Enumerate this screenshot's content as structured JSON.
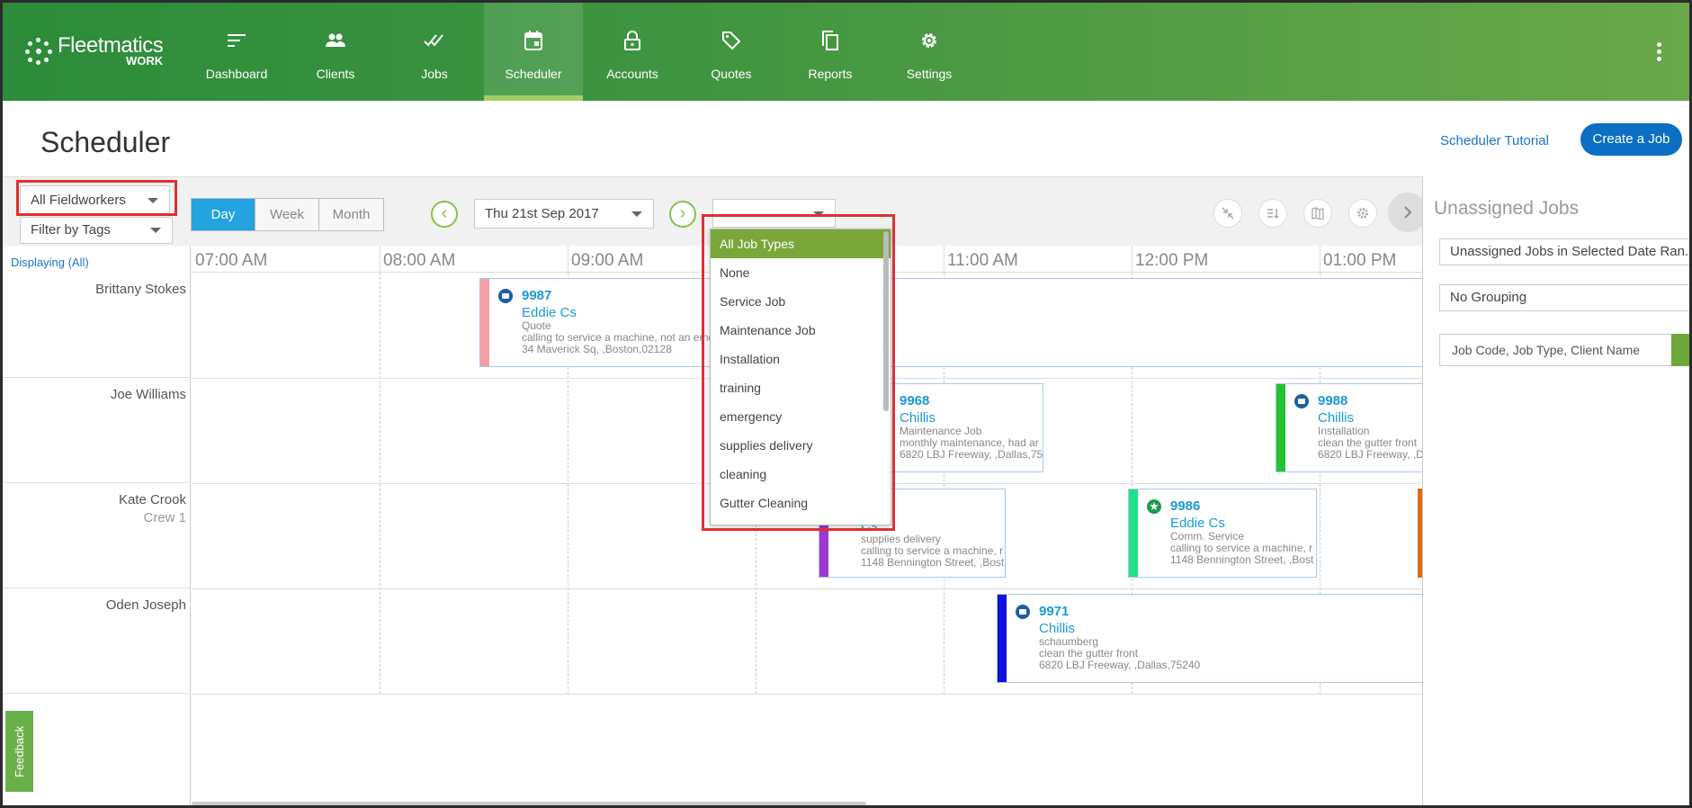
{
  "app": {
    "logo_name": "Fleetmatics",
    "logo_sub": "WORK"
  },
  "nav": [
    {
      "label": "Dashboard",
      "icon": "dashboard-icon"
    },
    {
      "label": "Clients",
      "icon": "clients-icon"
    },
    {
      "label": "Jobs",
      "icon": "jobs-icon"
    },
    {
      "label": "Scheduler",
      "icon": "calendar-icon",
      "active": true
    },
    {
      "label": "Accounts",
      "icon": "lock-icon"
    },
    {
      "label": "Quotes",
      "icon": "tag-icon"
    },
    {
      "label": "Reports",
      "icon": "copy-icon"
    },
    {
      "label": "Settings",
      "icon": "gear-icon"
    }
  ],
  "header": {
    "title": "Scheduler",
    "tutorial_link": "Scheduler Tutorial",
    "create_button": "Create a Job"
  },
  "filters": {
    "fieldworkers": "All Fieldworkers",
    "tags_placeholder": "Filter by Tags",
    "view_modes": [
      "Day",
      "Week",
      "Month"
    ],
    "active_view": "Day",
    "date": "Thu 21st Sep 2017",
    "job_type_value": ""
  },
  "job_types": [
    "All Job Types",
    "None",
    "Service Job",
    "Maintenance Job",
    "Installation",
    "training",
    "emergency",
    "supplies delivery",
    "cleaning",
    "Gutter Cleaning"
  ],
  "grid": {
    "displaying": "Displaying (All)",
    "hours": [
      "07:00 AM",
      "08:00 AM",
      "09:00 AM",
      "11:00 AM",
      "12:00 PM",
      "01:00 PM"
    ],
    "workers": [
      {
        "name": "Brittany Stokes",
        "crew": ""
      },
      {
        "name": "Joe Williams",
        "crew": ""
      },
      {
        "name": "Kate Crook",
        "crew": "Crew 1"
      },
      {
        "name": "Oden Joseph",
        "crew": ""
      }
    ]
  },
  "jobs": {
    "j9987": {
      "code": "9987",
      "client": "Eddie Cs",
      "type": "Quote",
      "desc": "calling to service a machine, not an eme",
      "addr": "34 Maverick Sq, ,Boston,02128",
      "color": "#f4a0a8"
    },
    "j9968": {
      "code": "9968",
      "client": "Chillis",
      "type": "Maintenance Job",
      "desc": "monthly maintenance, had ar",
      "addr": "6820 LBJ Freeway, ,Dallas,752",
      "color": "#9a7fd0"
    },
    "j9988": {
      "code": "9988",
      "client": "Chillis",
      "type": "Installation",
      "desc": "clean the gutter front",
      "addr": "6820 LBJ Freeway, ,Da",
      "color": "#22c230"
    },
    "jcs": {
      "code": "",
      "client": "Cs",
      "type": "supplies delivery",
      "desc": "calling to service a machine, r",
      "addr": "1148 Bennington Street, ,Bost",
      "color": "#9a3ad0"
    },
    "j9986": {
      "code": "9986",
      "client": "Eddie Cs",
      "type": "Comm. Service",
      "desc": "calling to service a machine, r",
      "addr": "1148 Bennington Street, ,Bost",
      "color": "#22e08a"
    },
    "j9971": {
      "code": "9971",
      "client": "Chillis",
      "type": "schaumberg",
      "desc": "clean the gutter front",
      "addr": "6820 LBJ Freeway, ,Dallas,75240",
      "color": "#1010e0"
    }
  },
  "right_panel": {
    "title": "Unassigned Jobs",
    "range_select": "Unassigned Jobs in Selected Date Ran...",
    "grouping_select": "No Grouping",
    "search_placeholder": "Job Code, Job Type, Client Name"
  },
  "feedback": "Feedback",
  "colors": {
    "nav_green": "#3f9440",
    "accent_blue": "#0b6fc4",
    "selected_green": "#7aa63a",
    "highlight_red": "#e03030"
  }
}
